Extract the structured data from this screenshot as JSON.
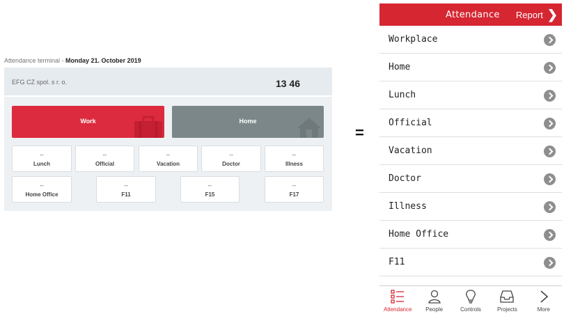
{
  "terminal": {
    "caption_prefix": "Attendance terminal - ",
    "caption_date": "Monday 21. October 2019",
    "company": "EFG CZ spol. s r. o.",
    "time": "13 46",
    "primary": [
      {
        "label": "Work",
        "color": "#dc2a3e"
      },
      {
        "label": "Home",
        "color": "#7c8789"
      }
    ],
    "row1": [
      {
        "arrow": "↔",
        "label": "Lunch"
      },
      {
        "arrow": "↔",
        "label": "Official"
      },
      {
        "arrow": "↔",
        "label": "Vacation"
      },
      {
        "arrow": "↔",
        "label": "Doctor"
      },
      {
        "arrow": "↔",
        "label": "Illness"
      }
    ],
    "row2": [
      {
        "arrow": "↔",
        "label": "Home Office"
      },
      {
        "arrow": "↔",
        "label": "F11"
      },
      {
        "arrow": "↔",
        "label": "F15"
      },
      {
        "arrow": "↔",
        "label": "F17"
      }
    ]
  },
  "equals": "=",
  "phone": {
    "header": {
      "title": "Attendance",
      "report": "Report",
      "color": "#d52632"
    },
    "items": [
      {
        "label": "Workplace"
      },
      {
        "label": "Home"
      },
      {
        "label": "Lunch"
      },
      {
        "label": "Official"
      },
      {
        "label": "Vacation"
      },
      {
        "label": "Doctor"
      },
      {
        "label": "Illness"
      },
      {
        "label": "Home Office"
      },
      {
        "label": "F11"
      }
    ],
    "tabs": [
      {
        "label": "Attendance",
        "icon": "attendance-list-icon",
        "active": true
      },
      {
        "label": "People",
        "icon": "person-icon",
        "active": false
      },
      {
        "label": "Controls",
        "icon": "lightbulb-icon",
        "active": false
      },
      {
        "label": "Projects",
        "icon": "inbox-tray-icon",
        "active": false
      },
      {
        "label": "More",
        "icon": "chevron-right-icon",
        "active": false
      }
    ]
  }
}
